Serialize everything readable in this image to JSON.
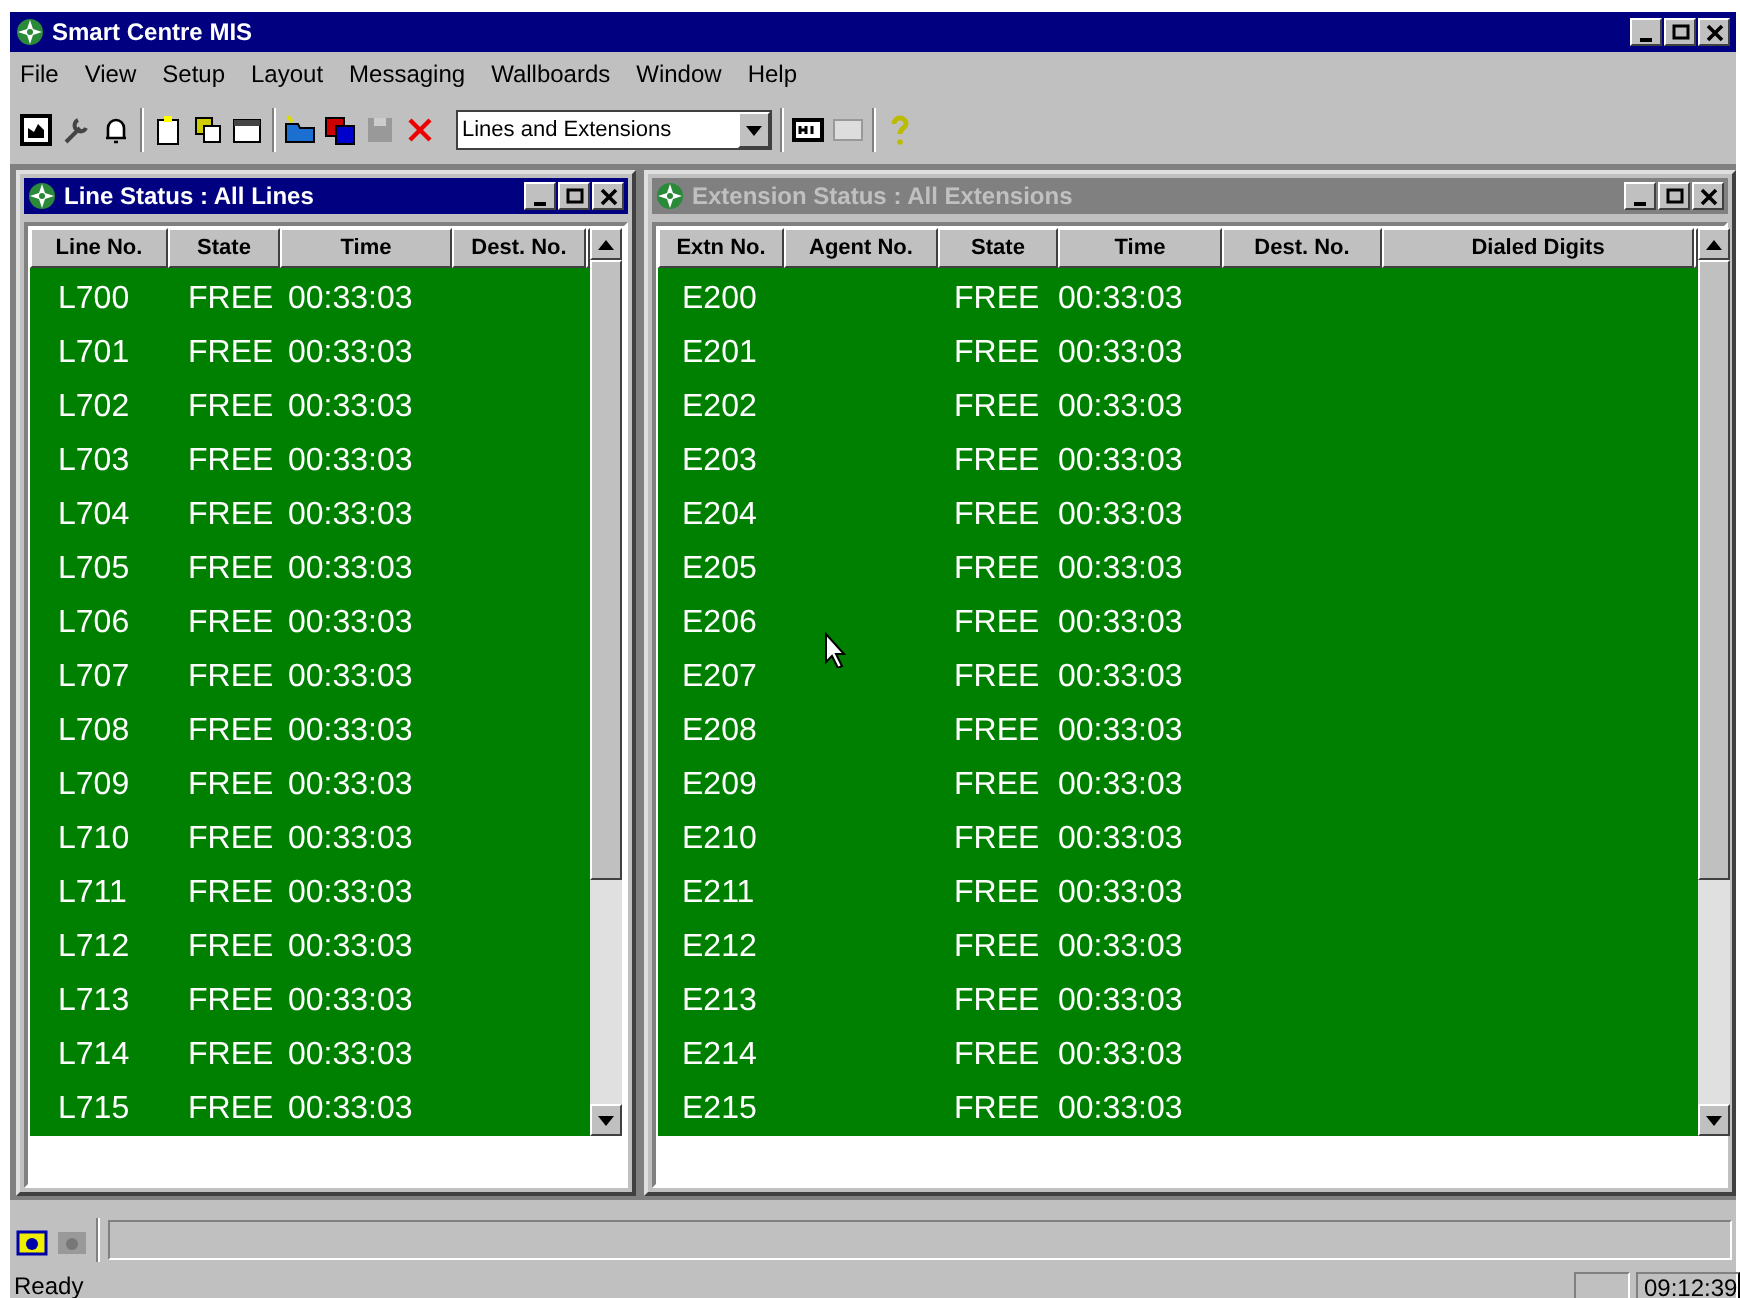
{
  "window": {
    "title": "Smart Centre MIS"
  },
  "menu": [
    "File",
    "View",
    "Setup",
    "Layout",
    "Messaging",
    "Wallboards",
    "Window",
    "Help"
  ],
  "toolbar": {
    "view_select": "Lines and Extensions"
  },
  "line_status": {
    "title": "Line Status : All Lines",
    "active": true,
    "columns": [
      "Line No.",
      "State",
      "Time",
      "Dest. No."
    ],
    "rows": [
      [
        "L700",
        "FREE",
        "00:33:03"
      ],
      [
        "L701",
        "FREE",
        "00:33:03"
      ],
      [
        "L702",
        "FREE",
        "00:33:03"
      ],
      [
        "L703",
        "FREE",
        "00:33:03"
      ],
      [
        "L704",
        "FREE",
        "00:33:03"
      ],
      [
        "L705",
        "FREE",
        "00:33:03"
      ],
      [
        "L706",
        "FREE",
        "00:33:03"
      ],
      [
        "L707",
        "FREE",
        "00:33:03"
      ],
      [
        "L708",
        "FREE",
        "00:33:03"
      ],
      [
        "L709",
        "FREE",
        "00:33:03"
      ],
      [
        "L710",
        "FREE",
        "00:33:03"
      ],
      [
        "L711",
        "FREE",
        "00:33:03"
      ],
      [
        "L712",
        "FREE",
        "00:33:03"
      ],
      [
        "L713",
        "FREE",
        "00:33:03"
      ],
      [
        "L714",
        "FREE",
        "00:33:03"
      ],
      [
        "L715",
        "FREE",
        "00:33:03"
      ]
    ]
  },
  "extension_status": {
    "title": "Extension Status : All Extensions",
    "active": false,
    "columns": [
      "Extn No.",
      "Agent No.",
      "State",
      "Time",
      "Dest. No.",
      "Dialed Digits"
    ],
    "rows": [
      [
        "E200",
        "",
        "FREE",
        "00:33:03"
      ],
      [
        "E201",
        "",
        "FREE",
        "00:33:03"
      ],
      [
        "E202",
        "",
        "FREE",
        "00:33:03"
      ],
      [
        "E203",
        "",
        "FREE",
        "00:33:03"
      ],
      [
        "E204",
        "",
        "FREE",
        "00:33:03"
      ],
      [
        "E205",
        "",
        "FREE",
        "00:33:03"
      ],
      [
        "E206",
        "",
        "FREE",
        "00:33:03"
      ],
      [
        "E207",
        "",
        "FREE",
        "00:33:03"
      ],
      [
        "E208",
        "",
        "FREE",
        "00:33:03"
      ],
      [
        "E209",
        "",
        "FREE",
        "00:33:03"
      ],
      [
        "E210",
        "",
        "FREE",
        "00:33:03"
      ],
      [
        "E211",
        "",
        "FREE",
        "00:33:03"
      ],
      [
        "E212",
        "",
        "FREE",
        "00:33:03"
      ],
      [
        "E213",
        "",
        "FREE",
        "00:33:03"
      ],
      [
        "E214",
        "",
        "FREE",
        "00:33:03"
      ],
      [
        "E215",
        "",
        "FREE",
        "00:33:03"
      ]
    ]
  },
  "status_bar": {
    "message": "Ready",
    "clock": "09:12:39"
  }
}
